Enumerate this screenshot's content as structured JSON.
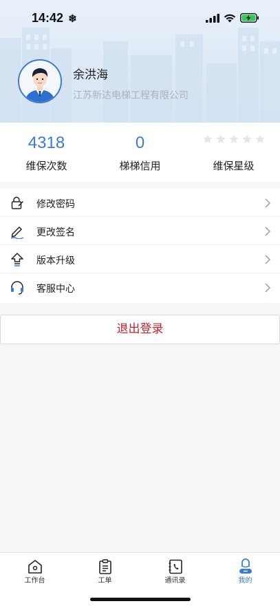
{
  "status_bar": {
    "time": "14:42",
    "extra_icon": "snowflake-icon",
    "icons": [
      "signal-icon",
      "wifi-icon",
      "battery-charging-icon"
    ]
  },
  "profile": {
    "name": "余洪海",
    "company": "江苏新达电梯工程有限公司"
  },
  "stats": [
    {
      "value": "4318",
      "label": "维保次数"
    },
    {
      "value": "0",
      "label": "梯梯信用"
    },
    {
      "rating": 0,
      "max_rating": 5,
      "label": "维保星级"
    }
  ],
  "menu": [
    {
      "label": "修改密码",
      "icon": "lock-edit-icon"
    },
    {
      "label": "更改签名",
      "icon": "pen-signature-icon"
    },
    {
      "label": "版本升级",
      "icon": "upgrade-arrow-icon"
    },
    {
      "label": "客服中心",
      "icon": "headset-icon"
    }
  ],
  "logout_label": "退出登录",
  "tabs": [
    {
      "label": "工作台",
      "icon": "home-icon",
      "active": false
    },
    {
      "label": "工单",
      "icon": "clipboard-icon",
      "active": false
    },
    {
      "label": "通讯录",
      "icon": "phone-book-icon",
      "active": false
    },
    {
      "label": "我的",
      "icon": "profile-icon",
      "active": true
    }
  ],
  "colors": {
    "accent": "#3a7bd5",
    "logout": "#c8202c",
    "header_bg": "#e3edf8"
  }
}
